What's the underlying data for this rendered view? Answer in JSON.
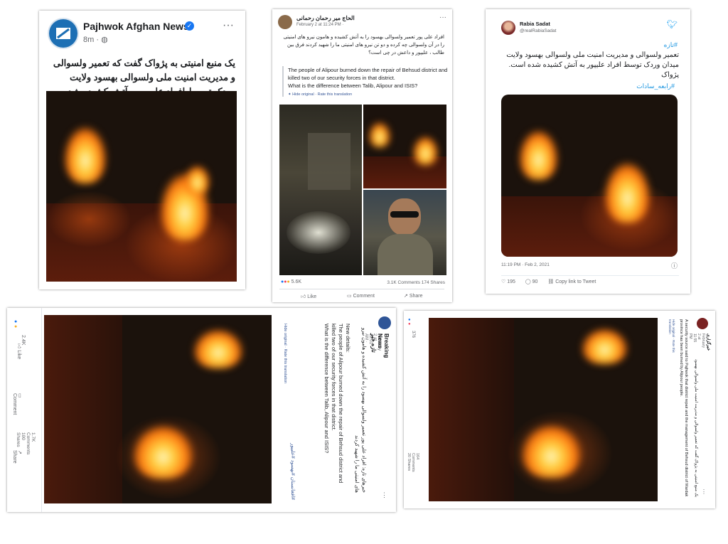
{
  "card1": {
    "author": "Pajhwok Afghan News",
    "time": "8m ·",
    "more": "···",
    "text": "یک منبع امنیتی به پژواک گفت که تعمیر ولسوالی و مدیریت امنیت ملی ولسوالی بهسود  ولایت وردک توسط افراد علیپور به آتش کشیده شده است."
  },
  "card2": {
    "author": "الحاج میر رحمان رحمانی",
    "time": "February 2 at 11:24 PM ·",
    "text": "افراد علی پور تعمیر ولسوالی بهسود را به آتش کشیده و هامون نیرو های امنیتی را در آن ولسوالی چه کرده و دو تن نیرو های امنیتی ما را شهید کردند فرق بین طالب ، علیپور و داعش در چی است؟",
    "translation": "The people of Alipour burned down the repair of Behsud district and killed two of our security forces in that district.\nWhat is the difference between Talib, Alipour and ISIS?",
    "hide_link": "Hide original · Rate this translation",
    "reactions": "5.6K",
    "comments_shares": "3.1K Comments  174 Shares",
    "like": "Like",
    "comment": "Comment",
    "share": "Share"
  },
  "card3": {
    "author": "Rabia Sadat",
    "handle": "@realRabiaSadat",
    "hashtag_top": "#تازه",
    "text": "تعمیر ولسوالی و مدیریت امنیت ملی ولسوالی بهسود  ولایت میدان وردک توسط افراد علیپور به آتش کشیده شده است.\nپژواک",
    "hashtag_bottom": "#رابعه_سادات",
    "timestamp": "11:19 PM · Feb 2, 2021",
    "likes": "195",
    "replies": "90",
    "copy_link": "Copy link to Tweet"
  },
  "card4": {
    "author": "Breaking News تازه خبر",
    "time": "February 2 at 12:01 AM ·",
    "text_fa": "خبرهای تازه: افراد علی پور تعمیر ولسوالی بهسود را به آتش کشیده و هامون نیرو های امنیتی ما را شهید کردند",
    "translation": "New details:\nThe people of Alipour burned down the repair of Behsud district and killed two of our security forces in that district.\nWhat is the difference between Talib, Alipour and ISIS?",
    "hide_link": "Hide original · Rate this translation",
    "hashtags": "#افغانستان #بهسود #علیپور",
    "reactions": "2.4K",
    "comments_shares": "1.7K Comments  100 Shares",
    "like": "Like",
    "comment": "Comment",
    "share": "Share"
  },
  "card5": {
    "author": "خبرگزاری",
    "time": "February 2 at 11:55 PM",
    "text_en": "A security source said to Pajhwok that district repair and the management of Behsud district of Wardak province has been burned by Alipour people.",
    "text_fa": "یک منبع امنیتی به پژواک گفت که تعمیر ولسوالی و مدیریت امنیت ملی ولسوالی بهسود",
    "hide_link": "Hide original · Rate this translation",
    "reactions": "376",
    "comments_shares": "164 Comments  20 Shares"
  }
}
